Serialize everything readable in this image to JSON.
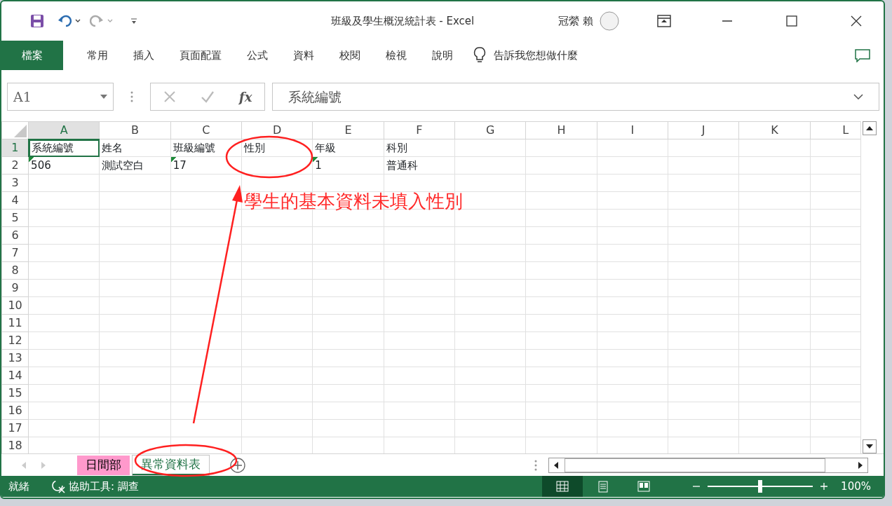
{
  "title_bar": {
    "title": "班級及學生概況統計表  -  Excel",
    "user": "冠縈 賴"
  },
  "ribbon_tabs": [
    {
      "label": "檔案",
      "kind": "file"
    },
    {
      "label": "常用",
      "kind": "tab"
    },
    {
      "label": "插入",
      "kind": "tab"
    },
    {
      "label": "頁面配置",
      "kind": "tab"
    },
    {
      "label": "公式",
      "kind": "tab"
    },
    {
      "label": "資料",
      "kind": "tab"
    },
    {
      "label": "校閱",
      "kind": "tab"
    },
    {
      "label": "檢視",
      "kind": "tab"
    },
    {
      "label": "說明",
      "kind": "tab"
    }
  ],
  "tell_me": "告訴我您想做什麼",
  "formula_bar": {
    "name_box": "A1",
    "fx": "fx",
    "value": "系統編號"
  },
  "columns": [
    {
      "label": "A",
      "selected": true
    },
    {
      "label": "B",
      "selected": false
    },
    {
      "label": "C",
      "selected": false
    },
    {
      "label": "D",
      "selected": false
    },
    {
      "label": "E",
      "selected": false
    },
    {
      "label": "F",
      "selected": false
    },
    {
      "label": "G",
      "selected": false
    },
    {
      "label": "H",
      "selected": false
    },
    {
      "label": "I",
      "selected": false
    },
    {
      "label": "J",
      "selected": false
    },
    {
      "label": "K",
      "selected": false
    },
    {
      "label": "L",
      "selected": false
    }
  ],
  "rows": [
    {
      "number": "1",
      "selected": true,
      "cells": [
        {
          "text": "系統編號",
          "flagged": false,
          "selected": true
        },
        {
          "text": "姓名",
          "flagged": false,
          "selected": false
        },
        {
          "text": "班級編號",
          "flagged": false,
          "selected": false
        },
        {
          "text": "性別",
          "flagged": false,
          "selected": false
        },
        {
          "text": "年級",
          "flagged": false,
          "selected": false
        },
        {
          "text": "科別",
          "flagged": false,
          "selected": false
        }
      ]
    },
    {
      "number": "2",
      "selected": false,
      "cells": [
        {
          "text": "506",
          "flagged": true,
          "selected": false
        },
        {
          "text": "測試空白",
          "flagged": false,
          "selected": false
        },
        {
          "text": "17",
          "flagged": true,
          "selected": false
        },
        {
          "flagged": false,
          "selected": false
        },
        {
          "text": "1",
          "flagged": true,
          "selected": false
        },
        {
          "text": "普通科",
          "flagged": false,
          "selected": false
        }
      ]
    },
    {
      "number": "3",
      "selected": false,
      "cells": []
    },
    {
      "number": "4",
      "selected": false,
      "cells": []
    },
    {
      "number": "5",
      "selected": false,
      "cells": []
    },
    {
      "number": "6",
      "selected": false,
      "cells": []
    },
    {
      "number": "7",
      "selected": false,
      "cells": []
    },
    {
      "number": "8",
      "selected": false,
      "cells": []
    },
    {
      "number": "9",
      "selected": false,
      "cells": []
    },
    {
      "number": "10",
      "selected": false,
      "cells": []
    },
    {
      "number": "11",
      "selected": false,
      "cells": []
    },
    {
      "number": "12",
      "selected": false,
      "cells": []
    },
    {
      "number": "13",
      "selected": false,
      "cells": []
    },
    {
      "number": "14",
      "selected": false,
      "cells": []
    },
    {
      "number": "15",
      "selected": false,
      "cells": []
    },
    {
      "number": "16",
      "selected": false,
      "cells": []
    },
    {
      "number": "17",
      "selected": false,
      "cells": []
    },
    {
      "number": "18",
      "selected": false,
      "cells": []
    }
  ],
  "sheet_tabs": [
    {
      "label": "日間部",
      "selected": false,
      "color": "#ff99cc"
    },
    {
      "label": "異常資料表",
      "selected": true
    }
  ],
  "status_bar": {
    "status": "就緒",
    "accessibility": "協助工具: 調查",
    "views": [
      {
        "kind": "normal",
        "selected": true
      },
      {
        "kind": "page-layout",
        "selected": false
      },
      {
        "kind": "page-break",
        "selected": false
      }
    ],
    "zoom": {
      "level": 0.5,
      "reading": "100%"
    }
  },
  "annotation": {
    "note": "學生的基本資料未填入性別"
  }
}
